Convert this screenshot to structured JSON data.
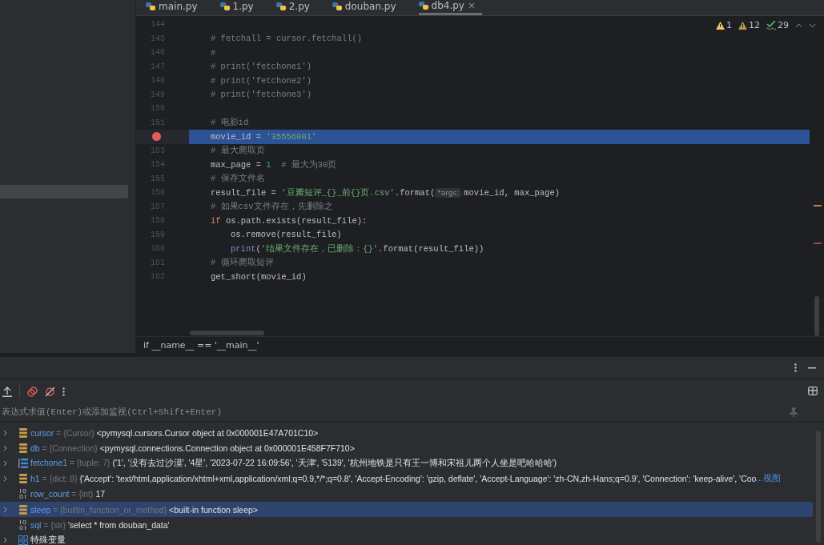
{
  "sidebar": {
    "items": [
      {
        "selected": true
      }
    ]
  },
  "editor_tabs": [
    {
      "label": "main.py",
      "selected": false
    },
    {
      "label": "1.py",
      "selected": false
    },
    {
      "label": "2.py",
      "selected": false
    },
    {
      "label": "douban.py",
      "selected": false
    },
    {
      "label": "db4.py",
      "selected": true,
      "close": "×"
    }
  ],
  "inspections": [
    {
      "kind": "warning",
      "count": "1"
    },
    {
      "kind": "weak",
      "count": "12"
    },
    {
      "kind": "typo",
      "count": "29"
    }
  ],
  "code_lines": [
    {
      "number": "144"
    },
    {
      "number": "145",
      "tokens": [
        {
          "kind": "comment",
          "text": "# fetchall = cursor.fetchall()"
        }
      ]
    },
    {
      "number": "146",
      "tokens": [
        {
          "kind": "comment",
          "text": "#"
        }
      ]
    },
    {
      "number": "147",
      "tokens": [
        {
          "kind": "comment",
          "text": "# print('fetchone1')"
        }
      ]
    },
    {
      "number": "148",
      "tokens": [
        {
          "kind": "comment",
          "text": "# print('fetchone2')"
        }
      ]
    },
    {
      "number": "149",
      "tokens": [
        {
          "kind": "comment",
          "text": "# print('fetchone3')"
        }
      ]
    },
    {
      "number": "150"
    },
    {
      "number": "151",
      "tokens": [
        {
          "kind": "comment",
          "text": "# 电影id"
        }
      ]
    },
    {
      "breakpoint": true,
      "selected": true,
      "tokens": [
        {
          "kind": "plain",
          "text": "movie_id = "
        },
        {
          "kind": "string",
          "text": "'35556001'"
        }
      ]
    },
    {
      "number": "153",
      "tokens": [
        {
          "kind": "comment",
          "text": "# 最大爬取页"
        }
      ]
    },
    {
      "number": "154",
      "tokens": [
        {
          "kind": "plain",
          "text": "max_page = "
        },
        {
          "kind": "number",
          "text": "1"
        },
        {
          "kind": "comment",
          "text": "  # 最大为30页"
        }
      ]
    },
    {
      "number": "155",
      "tokens": [
        {
          "kind": "comment",
          "text": "# 保存文件名"
        }
      ]
    },
    {
      "number": "156",
      "tokens": [
        {
          "kind": "plain",
          "text": "result_file = "
        },
        {
          "kind": "string",
          "text": "'豆瓣短评_{}_前{}页.csv'"
        },
        {
          "kind": "plain",
          "text": ".format("
        },
        {
          "kind": "hint",
          "text": "*args:"
        },
        {
          "kind": "plain",
          "text": "movie_id, max_page)"
        }
      ]
    },
    {
      "number": "157",
      "tokens": [
        {
          "kind": "comment",
          "text": "# 如果csv文件存在，先删除之"
        }
      ]
    },
    {
      "number": "158",
      "tokens": [
        {
          "kind": "keyword",
          "text": "if"
        },
        {
          "kind": "plain",
          "text": " os.path.exists(result_file):"
        }
      ],
      "children": [
        {
          "number": "159",
          "tokens": [
            {
              "kind": "plain",
              "text": "os.remove(result_file)"
            }
          ]
        },
        {
          "number": "160",
          "tokens": [
            {
              "kind": "builtin",
              "text": "print"
            },
            {
              "kind": "plain",
              "text": "("
            },
            {
              "kind": "string",
              "text": "'结果文件存在，已删除：{}'"
            },
            {
              "kind": "plain",
              "text": ".format(result_file))"
            }
          ]
        }
      ]
    },
    {
      "number": "161",
      "tokens": [
        {
          "kind": "comment",
          "text": "# 循环爬取短评"
        }
      ]
    },
    {
      "number": "162",
      "tokens": [
        {
          "kind": "plain",
          "text": "get_short(movie_id)"
        }
      ]
    }
  ],
  "breadcrumb": "if __name__ == '__main__'",
  "evaluate_field": {
    "placeholder": "表达式求值(Enter)或添加监视(Ctrl+Shift+Enter)"
  },
  "variables": [
    {
      "kind": "object",
      "expandable": true,
      "selected": false,
      "name": "cursor",
      "type": "= {Cursor}",
      "value": "<pymysql.cursors.Cursor object at 0x000001E47A701C10>"
    },
    {
      "kind": "object",
      "expandable": true,
      "selected": false,
      "name": "db",
      "type": "= {Connection}",
      "value": "<pymysql.connections.Connection object at 0x000001E458F7F710>"
    },
    {
      "kind": "list",
      "expandable": true,
      "selected": false,
      "name": "fetchone1",
      "type": "= {tuple: 7}",
      "value": "('1', '没有去过沙漠', '4星', '2023-07-22 16:09:56', '天津', '5139', '杭州地铁是只有王一博和宋祖儿两个人坐是吧哈哈哈')"
    },
    {
      "kind": "object",
      "expandable": true,
      "selected": false,
      "name": "h1",
      "type": "= {dict: 8}",
      "value": "{'Accept': 'text/html,application/xhtml+xml,application/xml;q=0.9,*/*;q=0.8', 'Accept-Encoding': 'gzip, deflate', 'Accept-Language': 'zh-CN,zh-Hans;q=0.9', 'Connection': 'keep-alive', 'Coo",
      "link": "...视图"
    },
    {
      "kind": "number",
      "expandable": false,
      "selected": false,
      "name": "row_count",
      "type": "= {int}",
      "value": "17"
    },
    {
      "kind": "object",
      "expandable": true,
      "selected": true,
      "name": "sleep",
      "type": "= {builtin_function_or_method}",
      "value": "<built-in function sleep>"
    },
    {
      "kind": "number",
      "expandable": false,
      "selected": false,
      "name": "sql",
      "type": "= {str}",
      "value": "'select * from douban_data'"
    },
    {
      "kind": "group",
      "expandable": true,
      "selected": false,
      "label": "特殊变量"
    }
  ]
}
